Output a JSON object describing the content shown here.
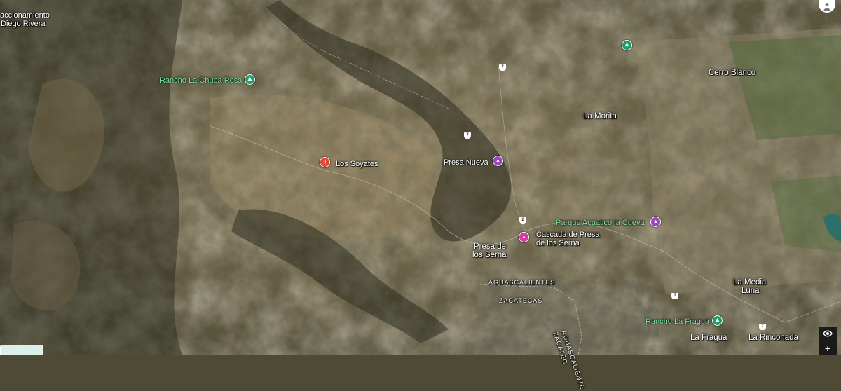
{
  "map": {
    "view": "satellite",
    "places": {
      "fraccionamiento": "accionamiento",
      "diego_rivera": "Diego Rivera",
      "rancho_chupa_rosa": "Rancho La Chupa Rosa",
      "los_soyates": "Los Soyates",
      "presa_nueva": "Presa Nueva",
      "la_morita": "La Morita",
      "cerro_blanco": "Cerro Blanco",
      "parque_acuatico": "Parque Acuático la Cueva",
      "cascada_line1": "Cascada de Presa",
      "cascada_line2": "de los Serna",
      "presa_serna_line1": "Presa de",
      "presa_serna_line2": "los Serna",
      "aguascalientes": "AGUASCALIENTES",
      "zacatecas": "ZACATECAS",
      "aguascalientes_diag": "AGUASCALIENTE",
      "zacatecas_diag": "ZACATEC",
      "la_media_line1": "La Media",
      "la_media_line2": "Luna",
      "rancho_fragua": "Rancho La Fragua",
      "la_fragua": "La Fragua",
      "la_rinconada": "La Rinconada"
    },
    "road_shields": [
      "7",
      "7",
      "2",
      "7",
      "7"
    ],
    "pin_icons": {
      "hiking": "hiking-icon",
      "restaurant": "restaurant-icon",
      "landmark": "landmark-icon",
      "scenic": "scenic-icon",
      "waterpark": "waterpark-icon"
    }
  },
  "controls": {
    "street_view_icon": "eye-icon",
    "zoom_in": "+"
  },
  "colors": {
    "green_label": "#7fe3a8",
    "pin_green": "#1e9e6a",
    "pin_red": "#d9483b",
    "pin_purple": "#9b45c2",
    "pin_pink": "#d63aa8"
  }
}
